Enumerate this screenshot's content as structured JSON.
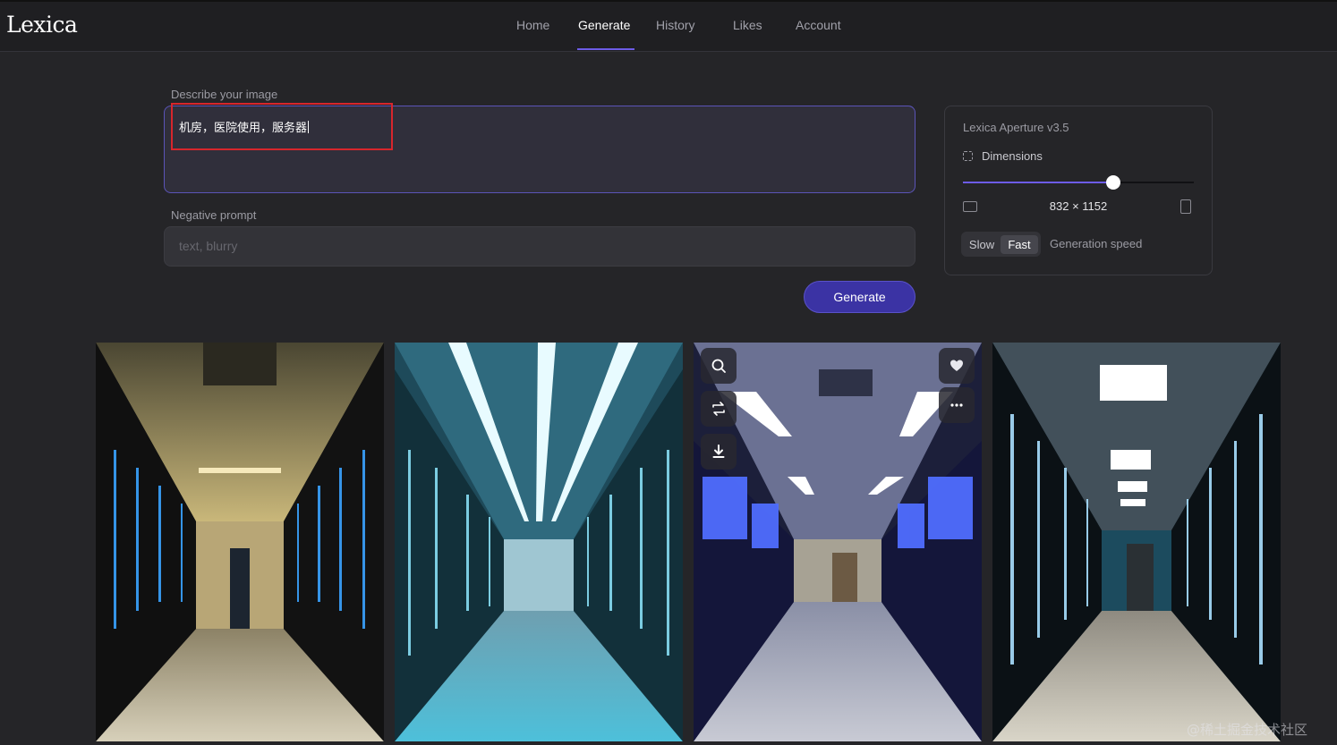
{
  "app": {
    "logo": "Lexica"
  },
  "nav": {
    "items": [
      {
        "label": "Home"
      },
      {
        "label": "Generate",
        "active": true
      },
      {
        "label": "History"
      },
      {
        "label": "Likes"
      },
      {
        "label": "Account"
      }
    ]
  },
  "prompt": {
    "label": "Describe your image",
    "value": "机房，医院使用，服务器"
  },
  "negative_prompt": {
    "label": "Negative prompt",
    "placeholder": "text, blurry",
    "value": ""
  },
  "generate_button": {
    "label": "Generate"
  },
  "settings": {
    "model": "Lexica Aperture v3.5",
    "dimensions_label": "Dimensions",
    "dimensions_value": "832 × 1152",
    "aspect_slider_fraction": 0.65,
    "speed_options": [
      "Slow",
      "Fast"
    ],
    "speed_selected": "Fast",
    "speed_label": "Generation speed"
  },
  "results": {
    "images": [
      {
        "scene": "server-corridor-warm"
      },
      {
        "scene": "server-corridor-cyan"
      },
      {
        "scene": "server-corridor-blue",
        "hovered": true
      },
      {
        "scene": "server-corridor-teal"
      }
    ],
    "hover_actions": [
      "search-icon",
      "repeat-icon",
      "download-icon",
      "heart-icon",
      "more-icon"
    ]
  },
  "colors": {
    "accent": "#6d5ce7",
    "button": "#3b33a4",
    "background": "#252528",
    "highlight_red": "#d7262c"
  },
  "watermark": "@稀土掘金技术社区"
}
